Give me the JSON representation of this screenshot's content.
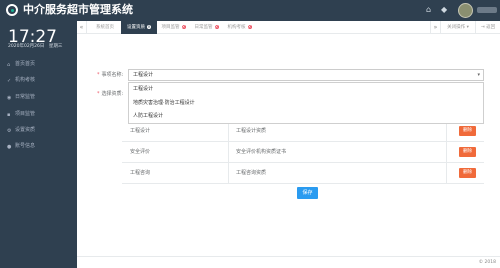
{
  "app": {
    "title": "中介服务超市管理系统"
  },
  "topbar": {
    "icons": [
      "home-icon",
      "bell-icon"
    ]
  },
  "sidebar": {
    "clock": "17:27",
    "date": "2020年02月26日　星期三",
    "items": [
      {
        "label": "首页首页",
        "icon": "home-icon"
      },
      {
        "label": "机构考核",
        "icon": "check-icon"
      },
      {
        "label": "日常监管",
        "icon": "eye-icon"
      },
      {
        "label": "项目监管",
        "icon": "folder-icon"
      },
      {
        "label": "设置资质",
        "icon": "gear-icon"
      },
      {
        "label": "账号信息",
        "icon": "user-icon"
      }
    ]
  },
  "tabs": {
    "items": [
      {
        "label": "系统首页",
        "active": false,
        "closable": false
      },
      {
        "label": "设置资质",
        "active": true,
        "closable": true
      },
      {
        "label": "项目监管",
        "active": false,
        "closable": true
      },
      {
        "label": "日常监管",
        "active": false,
        "closable": true
      },
      {
        "label": "机构考核",
        "active": false,
        "closable": true
      }
    ],
    "close_ops": "关闭操作",
    "back": "返回"
  },
  "form": {
    "field1_label": "事项名称:",
    "field2_label": "选择资质:",
    "selected": "工程设计",
    "options": [
      "工程设计",
      "地质灾害治理·防治工程设计",
      "人防工程设计"
    ]
  },
  "table": {
    "rows": [
      {
        "name": "工程设计",
        "qualification": "工程设计资质",
        "action": "删除"
      },
      {
        "name": "安全评价",
        "qualification": "安全评价机构资质证书",
        "action": "删除"
      },
      {
        "name": "工程咨询",
        "qualification": "工程咨询资质",
        "action": "删除"
      }
    ]
  },
  "save_label": "保存",
  "footer": {
    "copyright": "© 2018"
  },
  "colors": {
    "sidebar": "#2f4050",
    "primary": "#2a9bf0",
    "danger": "#f06a3a"
  }
}
